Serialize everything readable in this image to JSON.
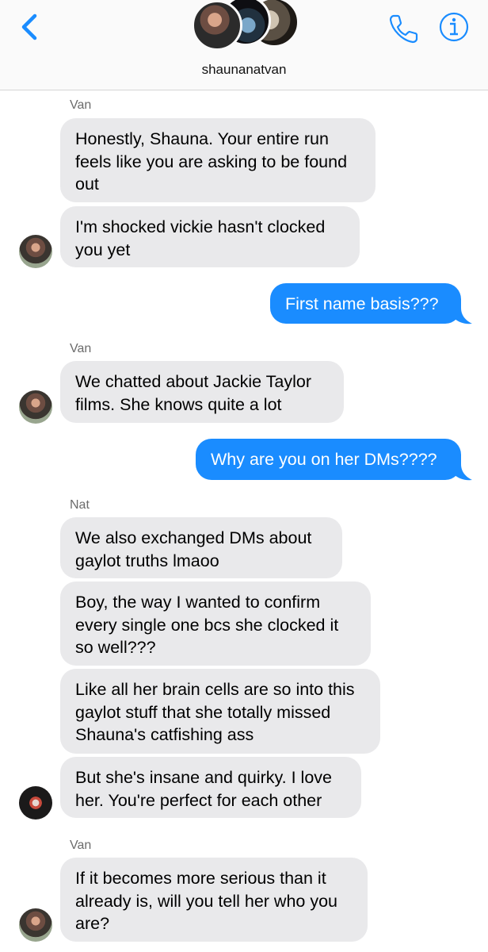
{
  "header": {
    "group_name": "shaunanatvan",
    "back_icon": "chevron-left-icon",
    "call_icon": "phone-icon",
    "info_icon": "info-icon",
    "accent": "#1a8cff"
  },
  "messages": [
    {
      "sender": "Van"
    },
    {
      "text": "Honestly, Shauna. Your entire run\nfeels like you are asking to be found\nout"
    },
    {
      "text": "I'm shocked vickie hasn't clocked\nyou yet"
    },
    {
      "text": "First name basis???"
    },
    {
      "sender": "Van"
    },
    {
      "text": "We chatted about Jackie Taylor\nfilms. She knows quite a lot"
    },
    {
      "text": "Why are you on her DMs????"
    },
    {
      "sender": "Nat"
    },
    {
      "text": "We also exchanged DMs about\ngaylot truths lmaoo"
    },
    {
      "text": "Boy, the way I wanted to confirm\nevery single one bcs she clocked it\nso well???"
    },
    {
      "text": "Like all her brain cells are so into this\ngaylot stuff that she totally missed\nShauna's catfishing ass"
    },
    {
      "text": "But she's insane and quirky. I love\nher. You're perfect for each other"
    },
    {
      "sender": "Van"
    },
    {
      "text": "If it becomes more serious than it\nalready is, will you tell her who you\nare?"
    }
  ]
}
